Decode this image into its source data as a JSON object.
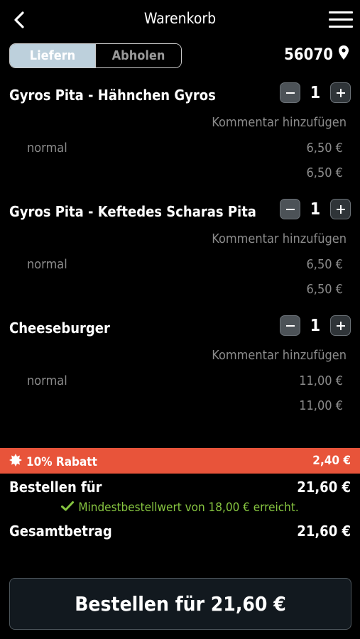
{
  "header": {
    "title": "Warenkorb"
  },
  "delivery_toggle": {
    "deliver_label": "Liefern",
    "pickup_label": "Abholen",
    "selected": "Liefern"
  },
  "location": {
    "zip": "56070"
  },
  "items": [
    {
      "name": "Gyros Pita - Hähnchen Gyros",
      "quantity": "1",
      "comment": "Kommentar hinzufügen",
      "variant": "normal",
      "variant_price": "6,50 €",
      "total": "6,50 €"
    },
    {
      "name": "Gyros Pita - Keftedes Scharas Pita",
      "quantity": "1",
      "comment": "Kommentar hinzufügen",
      "variant": "normal",
      "variant_price": "6,50 €",
      "total": "6,50 €"
    },
    {
      "name": "Cheeseburger",
      "quantity": "1",
      "comment": "Kommentar hinzufügen",
      "variant": "normal",
      "variant_price": "11,00 €",
      "total": "11,00 €"
    }
  ],
  "discount": {
    "label": "10% Rabatt",
    "amount": "2,40 €"
  },
  "summary": {
    "order_for_label": "Bestellen für",
    "order_for_value": "21,60 €",
    "min_order_message": "Mindestbestellwert von 18,00 € erreicht.",
    "total_label": "Gesamtbetrag",
    "total_value": "21,60 €"
  },
  "order_button": {
    "label": "Bestellen für 21,60 €"
  },
  "colors": {
    "discount_bg": "#e8543a",
    "success_green": "#86c540",
    "toggle_active": "#bdd0dc"
  }
}
